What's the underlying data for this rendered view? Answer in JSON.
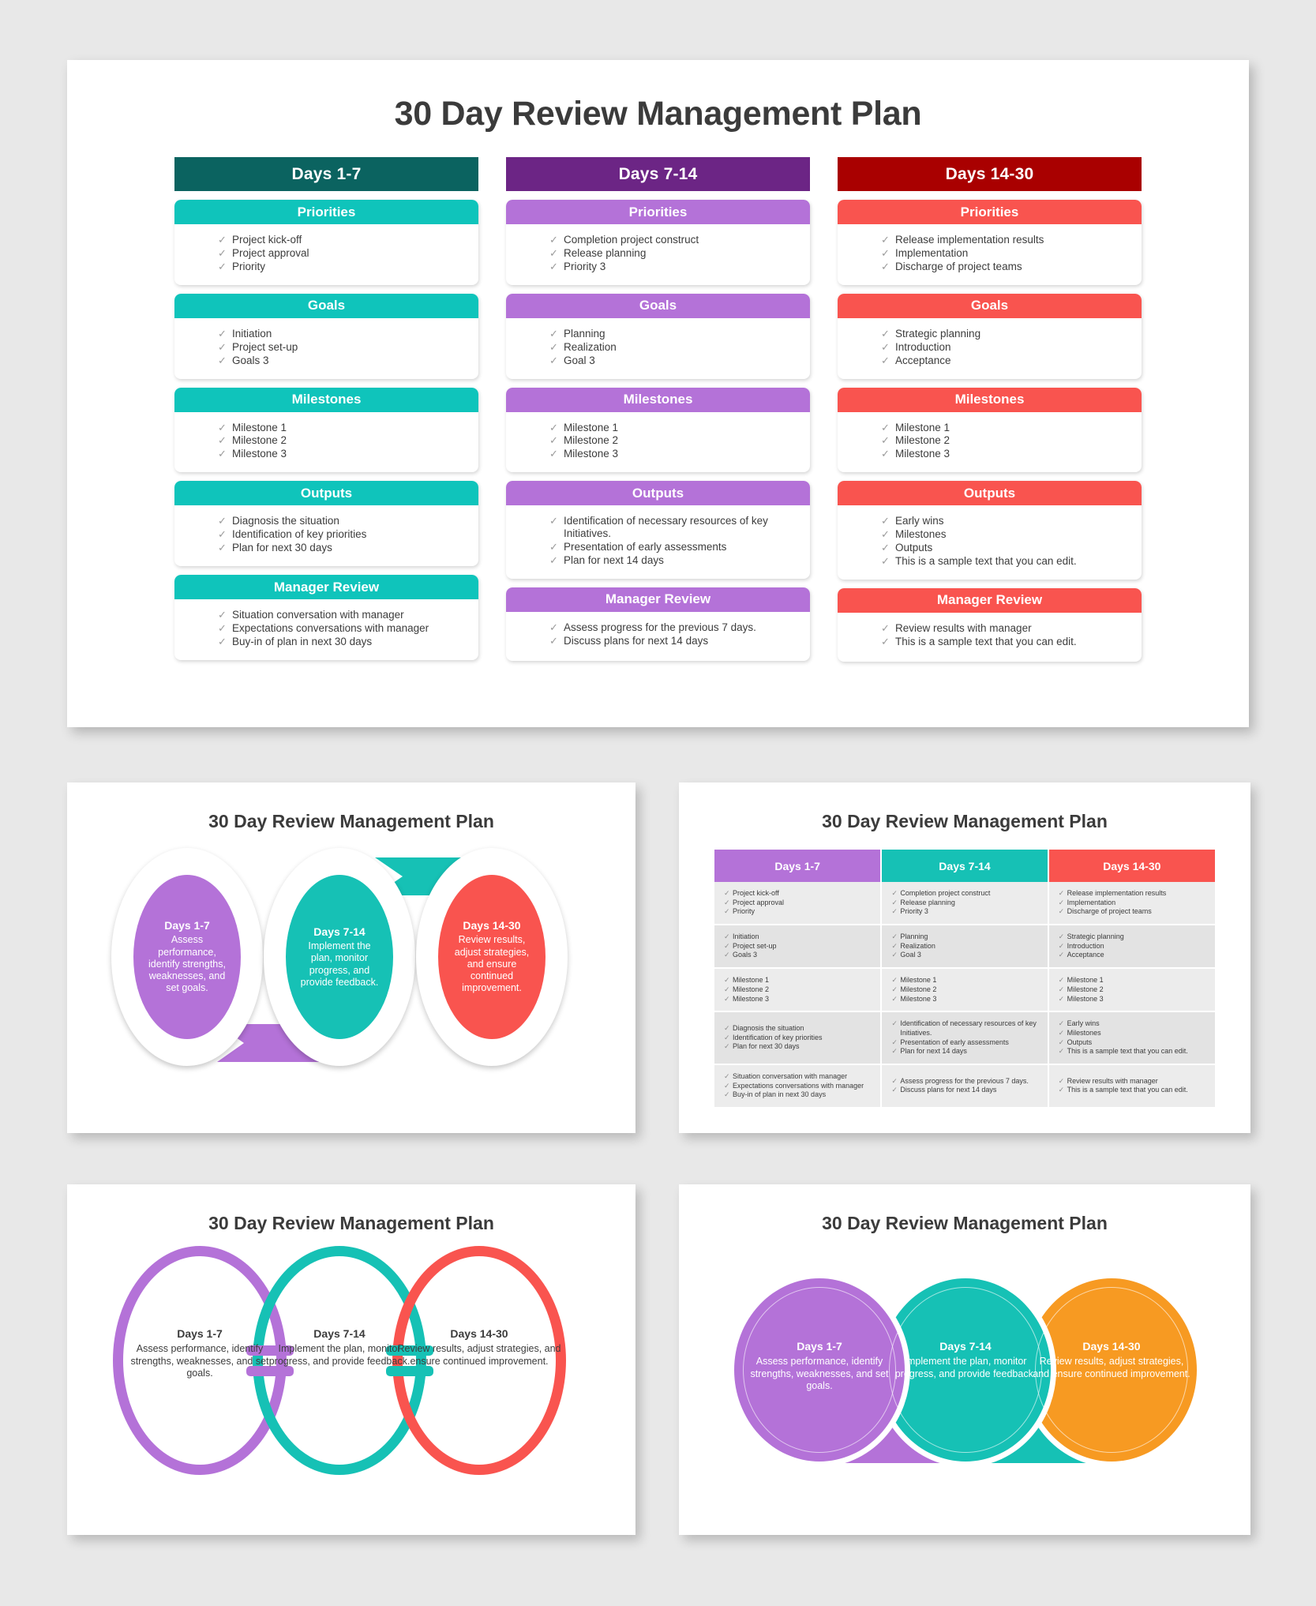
{
  "title": "30 Day Review Management Plan",
  "colors": {
    "col1_header": "#0b6360",
    "col1_accent": "#0fc4bb",
    "col2_header": "#6c2585",
    "col2_accent": "#b472d8",
    "col3_header": "#a90000",
    "col3_accent": "#f9544f",
    "purple": "#b472d8",
    "teal": "#16c1b5",
    "red": "#f9544f",
    "orange": "#f79a22",
    "title_text": "#3b3b3b"
  },
  "checkmark": "✓",
  "main": {
    "columns": [
      {
        "header": "Days 1-7",
        "head_color": "#0b6360",
        "accent": "#0fc4bb",
        "sections": [
          {
            "label": "Priorities",
            "items": [
              "Project kick-off",
              "Project approval",
              "Priority"
            ]
          },
          {
            "label": "Goals",
            "items": [
              "Initiation",
              "Project set-up",
              "Goals 3"
            ]
          },
          {
            "label": "Milestones",
            "items": [
              "Milestone 1",
              "Milestone 2",
              "Milestone 3"
            ]
          },
          {
            "label": "Outputs",
            "items": [
              "Diagnosis the situation",
              "Identification of key priorities",
              "Plan for next 30 days"
            ]
          },
          {
            "label": "Manager Review",
            "items": [
              "Situation conversation with manager",
              "Expectations conversations with manager",
              "Buy-in of plan in next 30 days"
            ]
          }
        ]
      },
      {
        "header": "Days 7-14",
        "head_color": "#6c2585",
        "accent": "#b472d8",
        "sections": [
          {
            "label": "Priorities",
            "items": [
              "Completion project construct",
              "Release planning",
              "Priority 3"
            ]
          },
          {
            "label": "Goals",
            "items": [
              "Planning",
              "Realization",
              "Goal 3"
            ]
          },
          {
            "label": "Milestones",
            "items": [
              "Milestone 1",
              "Milestone 2",
              "Milestone 3"
            ]
          },
          {
            "label": "Outputs",
            "items": [
              "Identification of necessary resources of key Initiatives.",
              "Presentation of early assessments",
              "Plan for next 14 days"
            ]
          },
          {
            "label": "Manager Review",
            "items": [
              "Assess progress for the previous 7 days.",
              "Discuss plans for next 14 days"
            ]
          }
        ]
      },
      {
        "header": "Days 14-30",
        "head_color": "#a90000",
        "accent": "#f9544f",
        "sections": [
          {
            "label": "Priorities",
            "items": [
              "Release implementation results",
              "Implementation",
              "Discharge of project teams"
            ]
          },
          {
            "label": "Goals",
            "items": [
              "Strategic planning",
              "Introduction",
              "Acceptance"
            ]
          },
          {
            "label": "Milestones",
            "items": [
              "Milestone 1",
              "Milestone 2",
              "Milestone 3"
            ]
          },
          {
            "label": "Outputs",
            "items": [
              "Early wins",
              "Milestones",
              "Outputs",
              "This is a sample text that you can edit."
            ]
          },
          {
            "label": "Manager Review",
            "items": [
              "Review results with manager",
              "This is a sample text that you can edit."
            ]
          }
        ]
      }
    ]
  },
  "thumb_ovals": {
    "title": "30 Day Review Management Plan",
    "stages": [
      {
        "head": "Days 1-7",
        "body": "Assess performance, identify strengths, weaknesses, and set goals.",
        "color": "#b472d8"
      },
      {
        "head": "Days 7-14",
        "body": "Implement the plan, monitor progress, and provide feedback.",
        "color": "#16c1b5"
      },
      {
        "head": "Days 14-30",
        "body": "Review results, adjust strategies, and ensure continued improvement.",
        "color": "#f9544f"
      }
    ]
  },
  "thumb_table": {
    "title": "30 Day Review Management Plan",
    "headers": [
      "Days 1-7",
      "Days 7-14",
      "Days 14-30"
    ],
    "header_colors": [
      "#b472d8",
      "#16c1b5",
      "#f9544f"
    ],
    "rows": [
      [
        [
          "Project kick-off",
          "Project approval",
          "Priority"
        ],
        [
          "Completion project construct",
          "Release planning",
          "Priority 3"
        ],
        [
          "Release implementation results",
          "Implementation",
          "Discharge of project teams"
        ]
      ],
      [
        [
          "Initiation",
          "Project set-up",
          "Goals 3"
        ],
        [
          "Planning",
          "Realization",
          "Goal 3"
        ],
        [
          "Strategic planning",
          "Introduction",
          "Acceptance"
        ]
      ],
      [
        [
          "Milestone 1",
          "Milestone 2",
          "Milestone 3"
        ],
        [
          "Milestone 1",
          "Milestone 2",
          "Milestone 3"
        ],
        [
          "Milestone 1",
          "Milestone 2",
          "Milestone 3"
        ]
      ],
      [
        [
          "Diagnosis the situation",
          "Identification of key priorities",
          "Plan for next 30 days"
        ],
        [
          "Identification of necessary resources of key Initiatives.",
          "Presentation of early assessments",
          "Plan for next 14 days"
        ],
        [
          "Early wins",
          "Milestones",
          "Outputs",
          "This is a sample text that you can edit."
        ]
      ],
      [
        [
          "Situation conversation with manager",
          "Expectations conversations with manager",
          "Buy-in of plan in next 30 days"
        ],
        [
          "Assess progress for the previous 7 days.",
          "Discuss plans for next 14 days"
        ],
        [
          "Review results with manager",
          "This is a sample text that you can edit."
        ]
      ]
    ]
  },
  "thumb_rings": {
    "title": "30 Day Review Management Plan",
    "stages": [
      {
        "head": "Days 1-7",
        "body": "Assess performance, identify strengths, weaknesses, and set goals.",
        "color": "#b472d8"
      },
      {
        "head": "Days 7-14",
        "body": "Implement the plan, monitor progress, and provide feedback.",
        "color": "#16c1b5"
      },
      {
        "head": "Days 14-30",
        "body": "Review results, adjust strategies, and ensure continued improvement.",
        "color": "#f9544f"
      }
    ]
  },
  "thumb_blobs": {
    "title": "30 Day Review Management Plan",
    "stages": [
      {
        "head": "Days 1-7",
        "body": "Assess performance, identify strengths, weaknesses, and set goals.",
        "color": "#b472d8"
      },
      {
        "head": "Days 7-14",
        "body": "Implement the plan, monitor progress, and provide feedback.",
        "color": "#16c1b5"
      },
      {
        "head": "Days 14-30",
        "body": "Review results, adjust strategies, and ensure continued improvement.",
        "color": "#f79a22"
      }
    ]
  }
}
